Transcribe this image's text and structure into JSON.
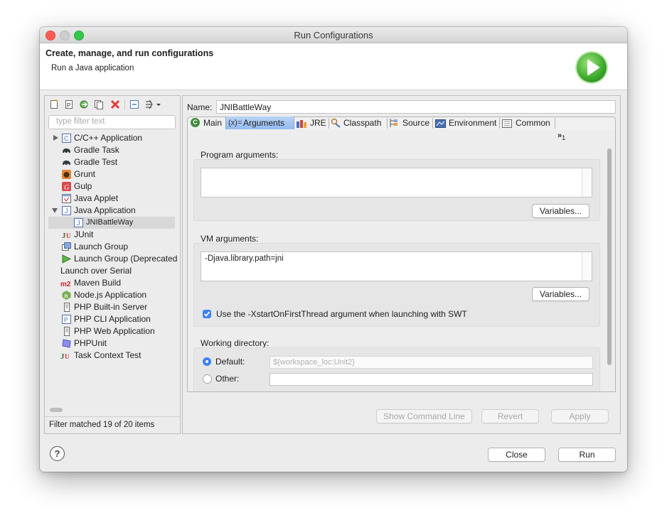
{
  "window": {
    "title": "Run Configurations"
  },
  "header": {
    "title": "Create, manage, and run configurations",
    "subtitle": "Run a Java application"
  },
  "sidebar": {
    "filter_placeholder": "type filter text",
    "items": [
      {
        "label": "C/C++ Application"
      },
      {
        "label": "Gradle Task"
      },
      {
        "label": "Gradle Test"
      },
      {
        "label": "Grunt"
      },
      {
        "label": "Gulp"
      },
      {
        "label": "Java Applet"
      },
      {
        "label": "Java Application"
      },
      {
        "label": "JNIBattleWay"
      },
      {
        "label": "JUnit"
      },
      {
        "label": "Launch Group"
      },
      {
        "label": "Launch Group (Deprecated"
      },
      {
        "label": "Launch over Serial"
      },
      {
        "label": "Maven Build"
      },
      {
        "label": "Node.js Application"
      },
      {
        "label": "PHP Built-in Server"
      },
      {
        "label": "PHP CLI Application"
      },
      {
        "label": "PHP Web Application"
      },
      {
        "label": "PHPUnit"
      },
      {
        "label": "Task Context Test"
      }
    ],
    "status": "Filter matched 19 of 20 items"
  },
  "config": {
    "name_label": "Name:",
    "name_value": "JNIBattleWay",
    "tabs": [
      {
        "label": "Main"
      },
      {
        "label": "Arguments"
      },
      {
        "label": "JRE"
      },
      {
        "label": "Classpath"
      },
      {
        "label": "Source"
      },
      {
        "label": "Environment"
      },
      {
        "label": "Common"
      }
    ],
    "overflow_indicator": "»",
    "overflow_count": "1",
    "program_args_label": "Program arguments:",
    "program_args_value": "",
    "vm_args_label": "VM arguments:",
    "vm_args_value": "-Djava.library.path=jni",
    "variables_label": "Variables...",
    "xstart_label": "Use the -XstartOnFirstThread argument when launching with SWT",
    "xstart_checked": true,
    "workdir_label": "Working directory:",
    "default_label": "Default:",
    "default_value": "${workspace_loc:Unit2}",
    "other_label": "Other:",
    "other_value": "",
    "workdir_selected": "Default"
  },
  "buttons": {
    "show_command_line": "Show Command Line",
    "revert": "Revert",
    "apply": "Apply",
    "close": "Close",
    "run": "Run"
  },
  "colors": {
    "accent": "#3b82f6",
    "selection": "#d8d8d8",
    "delete": "#e23b3b",
    "run_green": "#3aa82a"
  }
}
